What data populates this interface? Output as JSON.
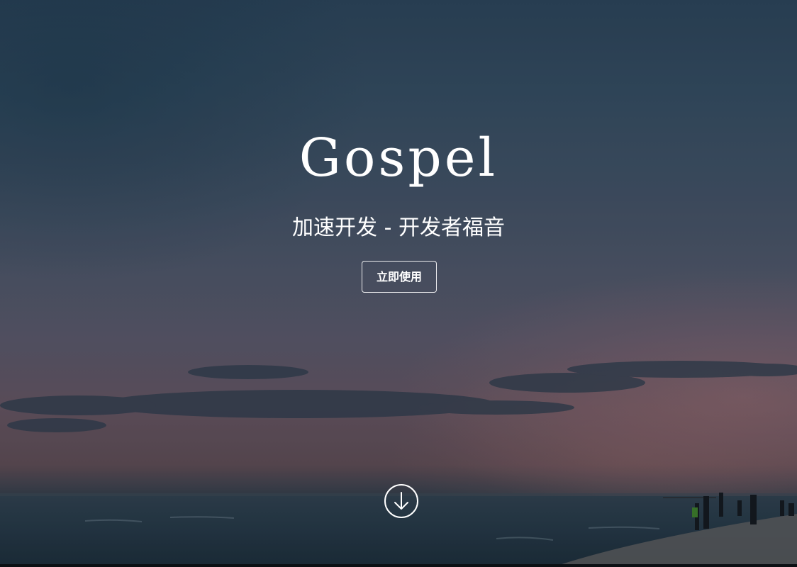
{
  "hero": {
    "title": "Gospel",
    "subtitle": "加速开发 - 开发者福音",
    "cta_label": "立即使用",
    "scroll_icon": "arrow-down-circle-icon"
  },
  "colors": {
    "text": "#ffffff",
    "sky_top": "#2b4257",
    "sky_mid": "#585567",
    "sunset": "#62525e",
    "sea": "#1d2d39"
  }
}
